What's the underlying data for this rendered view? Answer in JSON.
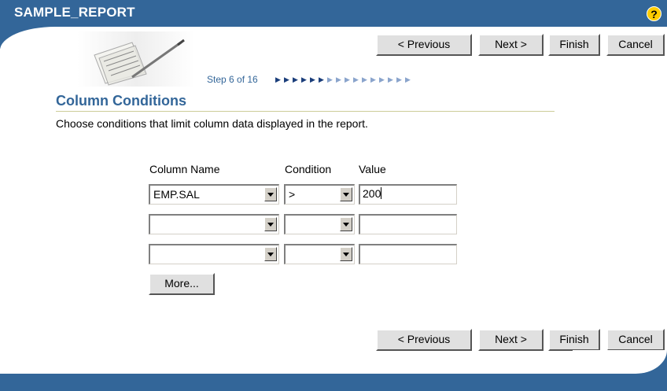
{
  "header": {
    "title": "SAMPLE_REPORT",
    "help_icon": "help-icon",
    "help_glyph": "?",
    "color": "#336699"
  },
  "nav": {
    "previous": "< Previous",
    "next": "Next >",
    "finish": "Finish",
    "cancel": "Cancel"
  },
  "step": {
    "text": "Step 6 of 16",
    "current": 6,
    "total": 16
  },
  "page": {
    "title": "Column Conditions",
    "instructions": "Choose conditions that limit column data displayed in the report."
  },
  "table": {
    "headers": {
      "column_name": "Column Name",
      "condition": "Condition",
      "value": "Value"
    },
    "rows": [
      {
        "column_name": "EMP.SAL",
        "condition": ">",
        "value": "200"
      },
      {
        "column_name": "",
        "condition": "",
        "value": ""
      },
      {
        "column_name": "",
        "condition": "",
        "value": ""
      }
    ]
  },
  "more_button": "More..."
}
